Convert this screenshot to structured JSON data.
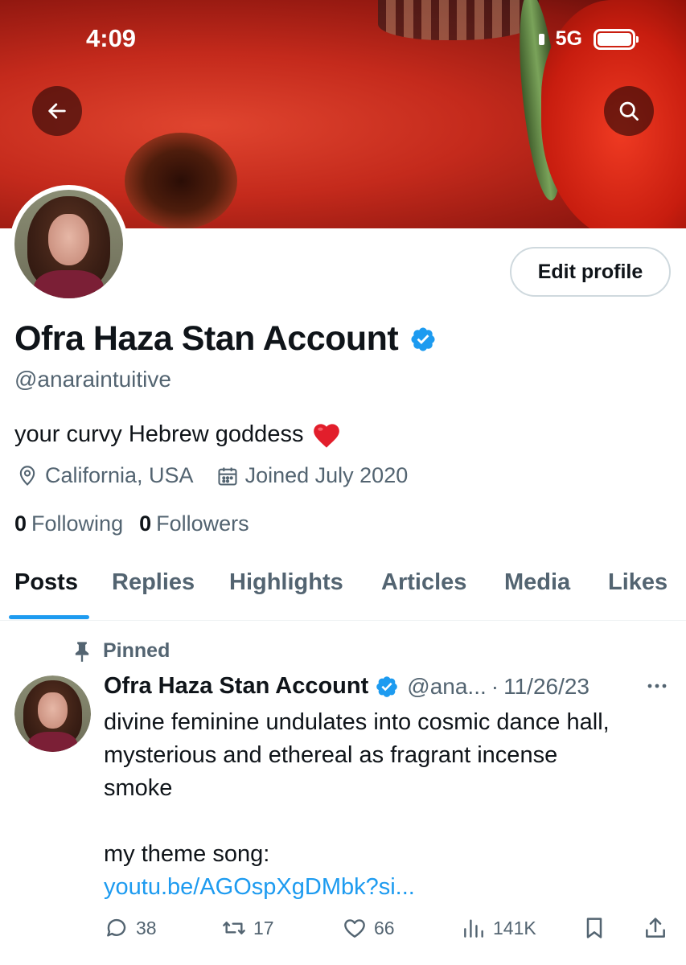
{
  "status_bar": {
    "time": "4:09",
    "network": "5G"
  },
  "banner": {
    "back_icon": "arrow-left-icon",
    "search_icon": "search-icon"
  },
  "profile": {
    "edit_button": "Edit profile",
    "display_name": "Ofra Haza Stan Account",
    "handle": "@anaraintuitive",
    "bio": "your curvy Hebrew goddess",
    "bio_emoji": "heart-emoji",
    "location": "California, USA",
    "joined": "Joined July 2020",
    "following_count": "0",
    "following_label": "Following",
    "followers_count": "0",
    "followers_label": "Followers",
    "verified_color": "#1d9bf0"
  },
  "tabs": [
    {
      "label": "Posts",
      "active": true
    },
    {
      "label": "Replies",
      "active": false
    },
    {
      "label": "Highlights",
      "active": false
    },
    {
      "label": "Articles",
      "active": false
    },
    {
      "label": "Media",
      "active": false
    },
    {
      "label": "Likes",
      "active": false
    }
  ],
  "pinned_tweet": {
    "pinned_label": "Pinned",
    "author_name": "Ofra Haza Stan Account",
    "author_handle": "@ana...",
    "separator": "·",
    "date": "11/26/23",
    "text_lines": [
      "divine feminine undulates into cosmic dance hall,",
      "mysterious and ethereal as fragrant incense",
      "smoke"
    ],
    "theme_line": "my theme song:",
    "link": "youtu.be/AGOspXgDMbk?si...",
    "replies": "38",
    "reposts": "17",
    "likes": "66",
    "views": "141K"
  },
  "colors": {
    "accent": "#1d9bf0",
    "secondary_text": "#536471",
    "primary_text": "#0f1419",
    "heart": "#e0245e"
  }
}
